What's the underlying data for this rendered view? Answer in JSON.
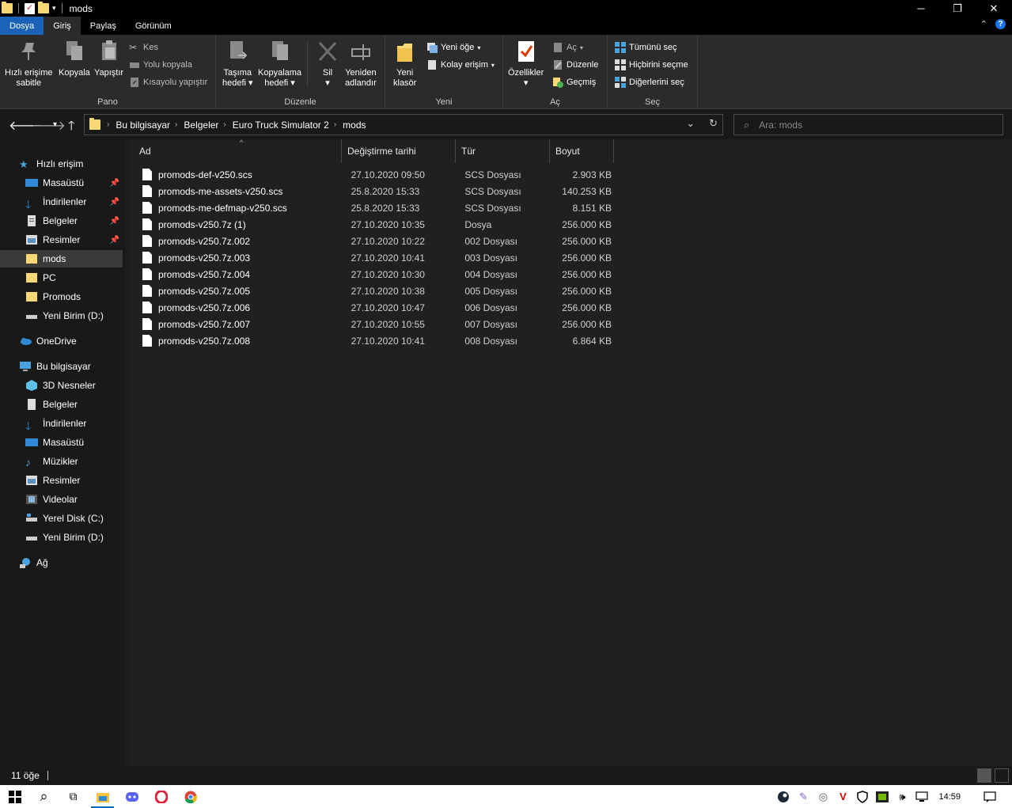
{
  "window": {
    "title": "mods",
    "minimize": "─",
    "restore": "❐",
    "close": "✕"
  },
  "ribbon_tabs": [
    "Dosya",
    "Giriş",
    "Paylaş",
    "Görünüm"
  ],
  "ribbon": {
    "pano": {
      "label": "Pano",
      "pin_label_1": "Hızlı erişime",
      "pin_label_2": "sabitle",
      "copy": "Kopyala",
      "paste": "Yapıştır",
      "cut": "Kes",
      "copy_path": "Yolu kopyala",
      "paste_shortcut": "Kısayolu yapıştır"
    },
    "duzenle": {
      "label": "Düzenle",
      "move_1": "Taşıma",
      "move_2": "hedefi",
      "copyto_1": "Kopyalama",
      "copyto_2": "hedefi",
      "delete": "Sil",
      "rename_1": "Yeniden",
      "rename_2": "adlandır"
    },
    "yeni": {
      "label": "Yeni",
      "folder_1": "Yeni",
      "folder_2": "klasör",
      "new_item": "Yeni öğe",
      "easy_access": "Kolay erişim"
    },
    "ac": {
      "label": "Aç",
      "properties": "Özellikler",
      "open": "Aç",
      "edit": "Düzenle",
      "history": "Geçmiş"
    },
    "sec": {
      "label": "Seç",
      "select_all": "Tümünü seç",
      "select_none": "Hiçbirini seçme",
      "invert": "Diğerlerini seç"
    }
  },
  "breadcrumb": [
    "Bu bilgisayar",
    "Belgeler",
    "Euro Truck Simulator 2",
    "mods"
  ],
  "search": {
    "placeholder": "Ara: mods"
  },
  "nav": {
    "quick_access": "Hızlı erişim",
    "quick_items": [
      "Masaüstü",
      "İndirilenler",
      "Belgeler",
      "Resimler",
      "mods",
      "PC",
      "Promods",
      "Yeni Birim (D:)"
    ],
    "onedrive": "OneDrive",
    "this_pc": "Bu bilgisayar",
    "pc_items": [
      "3D Nesneler",
      "Belgeler",
      "İndirilenler",
      "Masaüstü",
      "Müzikler",
      "Resimler",
      "Videolar",
      "Yerel Disk (C:)",
      "Yeni Birim (D:)"
    ],
    "network": "Ağ"
  },
  "columns": {
    "name": "Ad",
    "date": "Değiştirme tarihi",
    "type": "Tür",
    "size": "Boyut"
  },
  "files": [
    {
      "name": "promods-def-v250.scs",
      "date": "27.10.2020 09:50",
      "type": "SCS Dosyası",
      "size": "2.903 KB"
    },
    {
      "name": "promods-me-assets-v250.scs",
      "date": "25.8.2020 15:33",
      "type": "SCS Dosyası",
      "size": "140.253 KB"
    },
    {
      "name": "promods-me-defmap-v250.scs",
      "date": "25.8.2020 15:33",
      "type": "SCS Dosyası",
      "size": "8.151 KB"
    },
    {
      "name": "promods-v250.7z (1)",
      "date": "27.10.2020 10:35",
      "type": "Dosya",
      "size": "256.000 KB"
    },
    {
      "name": "promods-v250.7z.002",
      "date": "27.10.2020 10:22",
      "type": "002 Dosyası",
      "size": "256.000 KB"
    },
    {
      "name": "promods-v250.7z.003",
      "date": "27.10.2020 10:41",
      "type": "003 Dosyası",
      "size": "256.000 KB"
    },
    {
      "name": "promods-v250.7z.004",
      "date": "27.10.2020 10:30",
      "type": "004 Dosyası",
      "size": "256.000 KB"
    },
    {
      "name": "promods-v250.7z.005",
      "date": "27.10.2020 10:38",
      "type": "005 Dosyası",
      "size": "256.000 KB"
    },
    {
      "name": "promods-v250.7z.006",
      "date": "27.10.2020 10:47",
      "type": "006 Dosyası",
      "size": "256.000 KB"
    },
    {
      "name": "promods-v250.7z.007",
      "date": "27.10.2020 10:55",
      "type": "007 Dosyası",
      "size": "256.000 KB"
    },
    {
      "name": "promods-v250.7z.008",
      "date": "27.10.2020 10:41",
      "type": "008 Dosyası",
      "size": "6.864 KB"
    }
  ],
  "status": {
    "count": "11 öğe"
  },
  "taskbar": {
    "clock": "14:59"
  },
  "colors": {
    "accent": "#1a63b6",
    "folder": "#f8d775",
    "background": "#202020"
  }
}
